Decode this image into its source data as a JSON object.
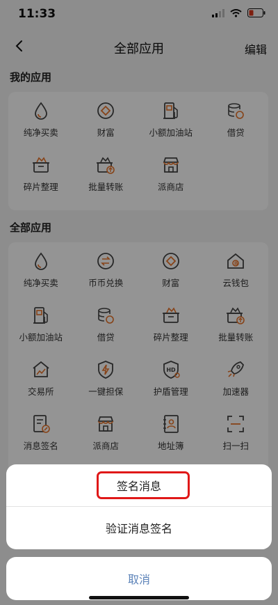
{
  "status_bar": {
    "time": "11:33"
  },
  "nav": {
    "title": "全部应用",
    "edit_label": "编辑"
  },
  "my_apps": {
    "title": "我的应用",
    "items": [
      {
        "label": "纯净买卖",
        "icon": "drop-icon"
      },
      {
        "label": "财富",
        "icon": "wealth-icon"
      },
      {
        "label": "小额加油站",
        "icon": "gas-station-icon"
      },
      {
        "label": "借贷",
        "icon": "coins-icon"
      },
      {
        "label": "碎片整理",
        "icon": "basket-icon"
      },
      {
        "label": "批量转账",
        "icon": "batch-transfer-icon"
      },
      {
        "label": "派商店",
        "icon": "store-icon"
      }
    ]
  },
  "all_apps": {
    "title": "全部应用",
    "items": [
      {
        "label": "纯净买卖",
        "icon": "drop-icon"
      },
      {
        "label": "币币兑换",
        "icon": "exchange-icon"
      },
      {
        "label": "财富",
        "icon": "wealth-icon"
      },
      {
        "label": "云钱包",
        "icon": "cloud-wallet-icon"
      },
      {
        "label": "小额加油站",
        "icon": "gas-station-icon"
      },
      {
        "label": "借贷",
        "icon": "coins-icon"
      },
      {
        "label": "碎片整理",
        "icon": "basket-icon"
      },
      {
        "label": "批量转账",
        "icon": "batch-transfer-icon"
      },
      {
        "label": "交易所",
        "icon": "exchange-house-icon"
      },
      {
        "label": "一键担保",
        "icon": "shield-bolt-icon"
      },
      {
        "label": "护盾管理",
        "icon": "hd-shield-icon"
      },
      {
        "label": "加速器",
        "icon": "rocket-icon"
      },
      {
        "label": "消息签名",
        "icon": "document-sign-icon"
      },
      {
        "label": "派商店",
        "icon": "store-icon"
      },
      {
        "label": "地址簿",
        "icon": "address-book-icon"
      },
      {
        "label": "扫一扫",
        "icon": "scan-icon"
      }
    ]
  },
  "action_sheet": {
    "options": [
      "签名消息",
      "验证消息签名"
    ],
    "cancel_label": "取消"
  },
  "colors": {
    "accent": "#e8742a",
    "icon_stroke": "#444444",
    "cancel": "#5b82b8",
    "highlight": "#e01818"
  }
}
